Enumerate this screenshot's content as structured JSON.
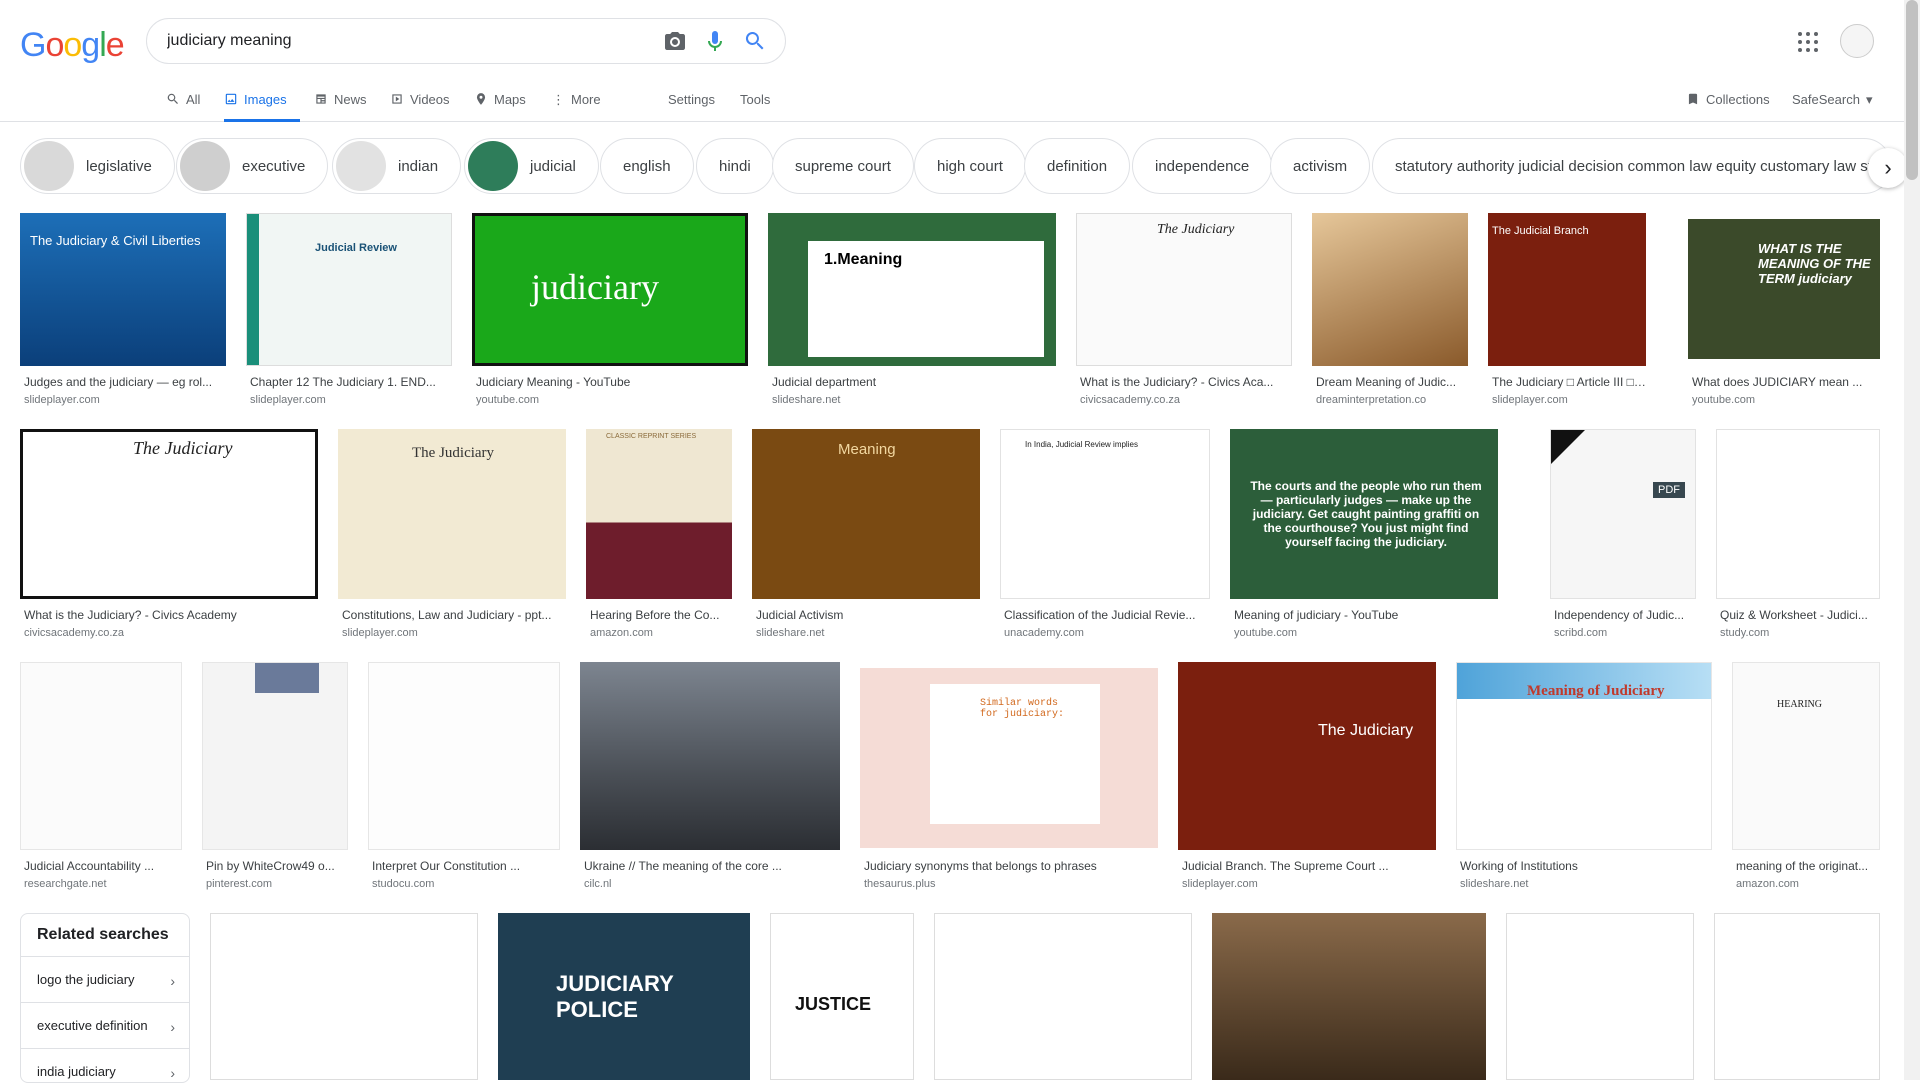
{
  "logo": "Google",
  "search": {
    "value": "judiciary meaning"
  },
  "tabs": {
    "all": "All",
    "images": "Images",
    "news": "News",
    "videos": "Videos",
    "maps": "Maps",
    "more": "More",
    "settings": "Settings",
    "tools": "Tools",
    "collections": "Collections",
    "safesearch": "SafeSearch"
  },
  "chips": [
    "legislative",
    "executive",
    "indian",
    "judicial",
    "english",
    "hindi",
    "supreme court",
    "high court",
    "definition",
    "independence",
    "activism",
    "statutory authority judicial decision common law equity customary law statory"
  ],
  "row1": [
    {
      "cap": "Judges and the judiciary — eg rol...",
      "src": "slideplayer.com",
      "text": "The Judiciary & Civil Liberties"
    },
    {
      "cap": "Chapter 12 The Judiciary 1. END...",
      "src": "slideplayer.com",
      "text": "Judicial Review"
    },
    {
      "cap": "Judiciary Meaning - YouTube",
      "src": "youtube.com",
      "text": "judiciary"
    },
    {
      "cap": "Judicial department",
      "src": "slideshare.net",
      "text": "1.Meaning"
    },
    {
      "cap": "What is the Judiciary? - Civics Aca...",
      "src": "civicsacademy.co.za",
      "text": "The Judiciary"
    },
    {
      "cap": "Dream Meaning of Judic...",
      "src": "dreaminterpretation.co",
      "text": ""
    },
    {
      "cap": "The Judiciary □ Article III □ ...",
      "src": "slideplayer.com",
      "text": "The Judicial Branch"
    },
    {
      "cap": "What does JUDICIARY mean ...",
      "src": "youtube.com",
      "text": "WHAT IS THE MEANING OF THE TERM judiciary"
    }
  ],
  "row2": [
    {
      "cap": "What is the Judiciary? - Civics Academy",
      "src": "civicsacademy.co.za",
      "text": "The Judiciary"
    },
    {
      "cap": "Constitutions, Law and Judiciary - ppt...",
      "src": "slideplayer.com",
      "text": "The Judiciary"
    },
    {
      "cap": "Hearing Before the Co...",
      "src": "amazon.com",
      "text": "CLASSIC REPRINT SERIES"
    },
    {
      "cap": "Judicial Activism",
      "src": "slideshare.net",
      "text": "Meaning"
    },
    {
      "cap": "Classification of the Judicial Revie...",
      "src": "unacademy.com",
      "text": "In India, Judicial Review implies"
    },
    {
      "cap": "Meaning of judiciary - YouTube",
      "src": "youtube.com",
      "text": "The courts and the people who run them — particularly judges — make up the judiciary. Get caught painting graffiti on the courthouse? You just might find yourself facing the judiciary."
    },
    {
      "cap": "Independency of Judic...",
      "src": "scribd.com",
      "text": "PDF"
    },
    {
      "cap": "Quiz & Worksheet - Judici...",
      "src": "study.com",
      "text": ""
    }
  ],
  "row3": [
    {
      "cap": "Judicial Accountability ...",
      "src": "researchgate.net",
      "text": ""
    },
    {
      "cap": "Pin by WhiteCrow49 o...",
      "src": "pinterest.com",
      "text": ""
    },
    {
      "cap": "Interpret Our Constitution ...",
      "src": "studocu.com",
      "text": ""
    },
    {
      "cap": "Ukraine // The meaning of the core ...",
      "src": "cilc.nl",
      "text": ""
    },
    {
      "cap": "Judiciary synonyms that belongs to phrases",
      "src": "thesaurus.plus",
      "text": "Similar words for judiciary:"
    },
    {
      "cap": "Judicial Branch. The Supreme Court ...",
      "src": "slideplayer.com",
      "text": "The Judiciary"
    },
    {
      "cap": "Working of Institutions",
      "src": "slideshare.net",
      "text": "Meaning of Judiciary"
    },
    {
      "cap": "meaning of the originat...",
      "src": "amazon.com",
      "text": "HEARING"
    }
  ],
  "row4": [
    {
      "text": ""
    },
    {
      "text": "JUDICIARY POLICE"
    },
    {
      "text": "JUSTICE"
    },
    {
      "text": ""
    },
    {
      "text": ""
    },
    {
      "text": ""
    },
    {
      "text": ""
    }
  ],
  "related": {
    "title": "Related searches",
    "items": [
      "logo the judiciary",
      "executive definition",
      "india judiciary"
    ]
  },
  "colors": {
    "accent": "#1a73e8",
    "blue": "#4285F4",
    "red": "#EA4335",
    "yellow": "#FBBC05",
    "green": "#34A853"
  }
}
